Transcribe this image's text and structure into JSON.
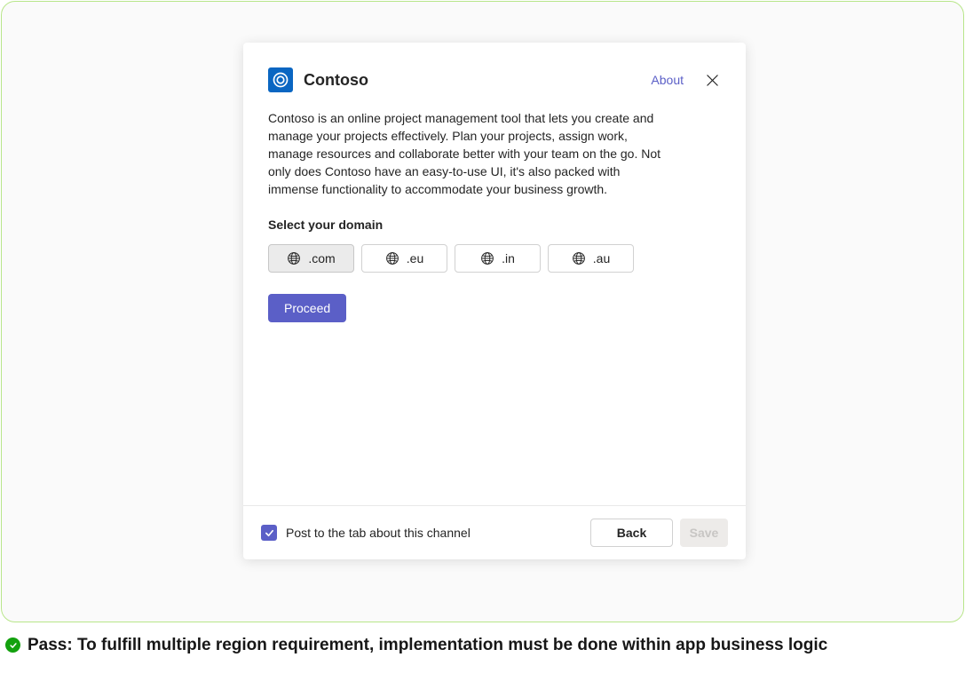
{
  "dialog": {
    "app_name": "Contoso",
    "about_label": "About",
    "description": "Contoso is an online project management tool that lets you create and manage your projects effectively. Plan your projects, assign work, manage resources and collaborate better with your team on the go. Not only does Contoso have an easy-to-use UI, it's also packed with immense functionality to accommodate your business growth.",
    "section_label": "Select your domain",
    "domains": [
      {
        "label": ".com",
        "selected": true
      },
      {
        "label": ".eu",
        "selected": false
      },
      {
        "label": ".in",
        "selected": false
      },
      {
        "label": ".au",
        "selected": false
      }
    ],
    "proceed_label": "Proceed",
    "checkbox_label": "Post to the tab about this channel",
    "checkbox_checked": true,
    "back_label": "Back",
    "save_label": "Save"
  },
  "pass_message": "Pass: To fulfill multiple region requirement, implementation must be done within app business logic"
}
